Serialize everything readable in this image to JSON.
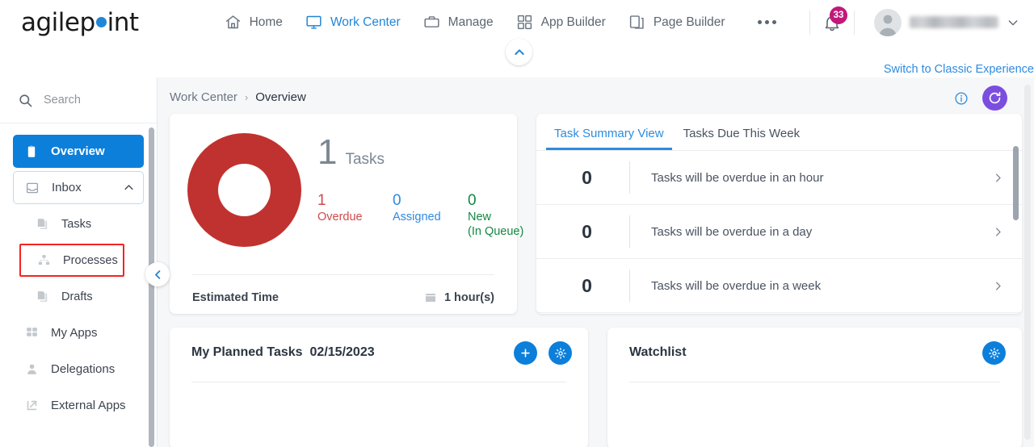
{
  "topbar": {
    "logo_before": "agilep",
    "logo_after": "int",
    "nav": [
      {
        "label": "Home",
        "icon": "home-icon",
        "active": false
      },
      {
        "label": "Work Center",
        "icon": "monitor-icon",
        "active": true
      },
      {
        "label": "Manage",
        "icon": "briefcase-icon",
        "active": false
      },
      {
        "label": "App Builder",
        "icon": "grid-icon",
        "active": false
      },
      {
        "label": "Page Builder",
        "icon": "pages-icon",
        "active": false
      }
    ],
    "more_label": "more-options",
    "notification_count": "33",
    "user_name": ""
  },
  "subheader": {
    "switch_classic": "Switch to Classic Experience"
  },
  "sidebar": {
    "search_placeholder": "Search",
    "items": [
      {
        "label": "Overview",
        "icon": "clipboard-icon",
        "state": "selected",
        "level": 0
      },
      {
        "label": "Inbox",
        "icon": "inbox-icon",
        "state": "expanded",
        "level": 0
      },
      {
        "label": "Tasks",
        "icon": "documents-icon",
        "state": "normal",
        "level": 1
      },
      {
        "label": "Processes",
        "icon": "sitemap-icon",
        "state": "highlighted",
        "level": 1
      },
      {
        "label": "Drafts",
        "icon": "documents-icon",
        "state": "normal",
        "level": 1
      },
      {
        "label": "My Apps",
        "icon": "apps-grid-icon",
        "state": "normal",
        "level": 0
      },
      {
        "label": "Delegations",
        "icon": "person-icon",
        "state": "normal",
        "level": 0
      },
      {
        "label": "External Apps",
        "icon": "external-link-icon",
        "state": "normal",
        "level": 0
      }
    ]
  },
  "breadcrumb": {
    "parent": "Work Center",
    "separator": "›",
    "current": "Overview"
  },
  "task_overview": {
    "total": "1",
    "total_label": "Tasks",
    "stats": [
      {
        "value": "1",
        "label": "Overdue",
        "color": "#d0494b"
      },
      {
        "value": "0",
        "label": "Assigned",
        "color": "#2f8ae0"
      },
      {
        "value": "0",
        "label": "New\n(In Queue)",
        "label_line1": "New",
        "label_line2": "(In Queue)",
        "color": "#138742"
      }
    ],
    "estimated_time_label": "Estimated Time",
    "estimated_time_value": "1 hour(s)",
    "donut_color": "#c0322f"
  },
  "chart_data": {
    "type": "pie",
    "title": "Task Summary Donut",
    "categories": [
      "Overdue",
      "Assigned",
      "New (In Queue)"
    ],
    "values": [
      1,
      0,
      0
    ],
    "colors": [
      "#c0322f",
      "#2f8ae0",
      "#138742"
    ],
    "total": 1,
    "total_label": "Tasks",
    "legend_position": "right",
    "donut": true,
    "annotations": [
      "Estimated Time: 1 hour(s)"
    ]
  },
  "task_summary": {
    "tabs": [
      {
        "label": "Task Summary View",
        "active": true
      },
      {
        "label": "Tasks Due This Week",
        "active": false
      }
    ],
    "rows": [
      {
        "count": "0",
        "text": "Tasks will be overdue in an hour"
      },
      {
        "count": "0",
        "text": "Tasks will be overdue in a day"
      },
      {
        "count": "0",
        "text": "Tasks will be overdue in a week"
      }
    ]
  },
  "planned_tasks": {
    "title": "My Planned Tasks",
    "date": "02/15/2023",
    "add_label": "add-planned-task",
    "settings_label": "planned-tasks-settings"
  },
  "watchlist": {
    "title": "Watchlist",
    "settings_label": "watchlist-settings"
  },
  "colors": {
    "accent_blue": "#0c7fdb",
    "link_blue": "#2e8bdd",
    "badge_pink": "#c2187b",
    "refresh_purple": "#7b4ee0",
    "highlight_red": "#f42424",
    "overdue_red": "#d0494b",
    "new_green": "#138742"
  }
}
